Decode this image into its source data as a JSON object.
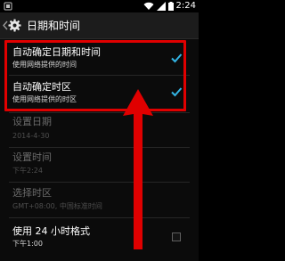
{
  "status_bar": {
    "time": "2:24"
  },
  "action_bar": {
    "title": "日期和时间"
  },
  "settings": [
    {
      "title": "自动确定日期和时间",
      "summary": "使用网络提供的时间",
      "checked": true,
      "enabled": true
    },
    {
      "title": "自动确定时区",
      "summary": "使用网络提供的时区",
      "checked": true,
      "enabled": true
    },
    {
      "title": "设置日期",
      "summary": "2014-4-30",
      "enabled": false
    },
    {
      "title": "设置时间",
      "summary": "下午2:24",
      "enabled": false
    },
    {
      "title": "选择时区",
      "summary": "GMT+08:00, 中国标准时间",
      "enabled": false
    },
    {
      "title": "使用 24 小时格式",
      "summary": "下午1:00",
      "checked": false,
      "enabled": true
    }
  ],
  "colors": {
    "highlight": "#e00000",
    "checkmark": "#33b5e5",
    "background": "#0b0b0b"
  }
}
